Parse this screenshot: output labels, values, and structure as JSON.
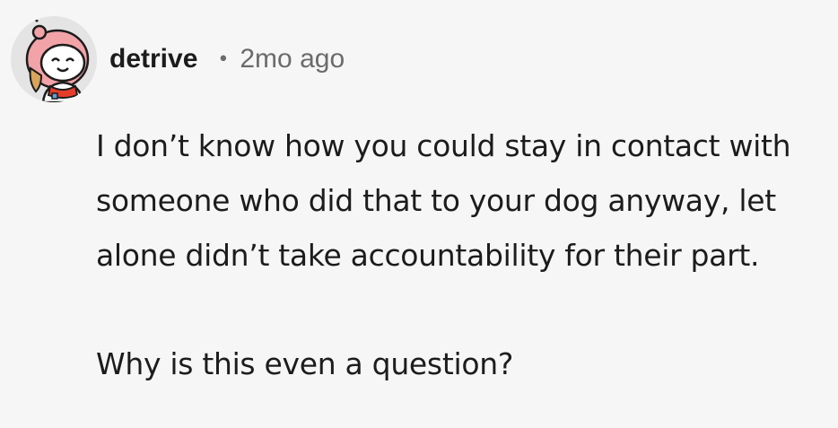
{
  "comment": {
    "author": "detrive",
    "separator": "•",
    "timestamp": "2mo ago",
    "avatar_icon": "snoo-avatar-pink-hood-icon",
    "paragraphs": [
      "I don’t know how you could stay in contact with someone who did that to your dog anyway, let alone didn’t take accountability for their part.",
      "Why is this even a question?"
    ]
  },
  "colors": {
    "background": "#f6f6f6",
    "text": "#1c1c1c",
    "meta": "#6b6b6b",
    "hood": "#f2a3a8"
  }
}
